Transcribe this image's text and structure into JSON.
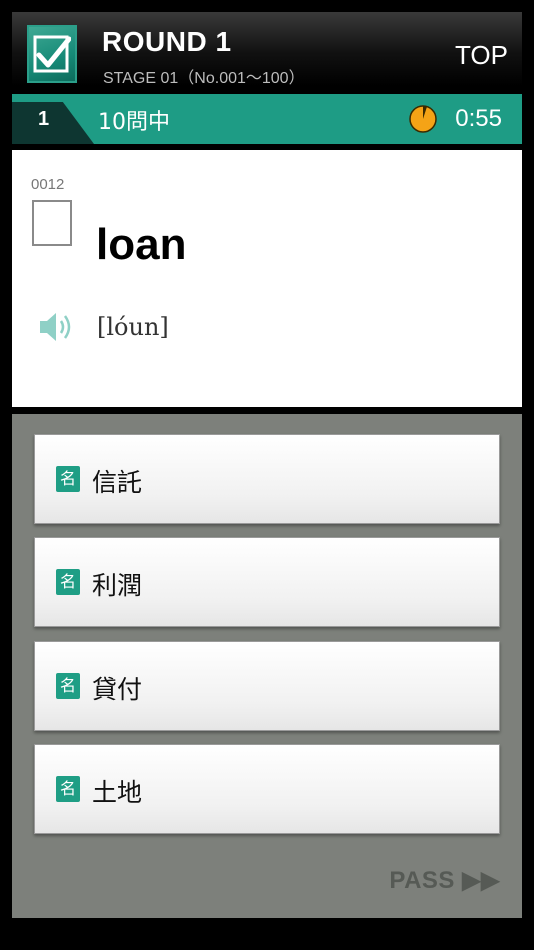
{
  "header": {
    "round_title": "ROUND 1",
    "stage": "STAGE 01（No.001～100）",
    "top_label": "TOP"
  },
  "progress": {
    "question_number": "1",
    "count_label": "10問中",
    "timer": "0:55"
  },
  "word": {
    "id": "0012",
    "text": "loan",
    "phonetic": "[lóun]"
  },
  "choices": [
    {
      "pos": "名",
      "text": "信託"
    },
    {
      "pos": "名",
      "text": "利潤"
    },
    {
      "pos": "名",
      "text": "貸付"
    },
    {
      "pos": "名",
      "text": "土地"
    }
  ],
  "pass_label": "PASS ▶▶",
  "colors": {
    "accent": "#1e9c85",
    "timer": "#f5a316",
    "background": "#7d807b"
  },
  "icons": [
    "check-logo-icon",
    "timer-icon",
    "speaker-icon"
  ]
}
